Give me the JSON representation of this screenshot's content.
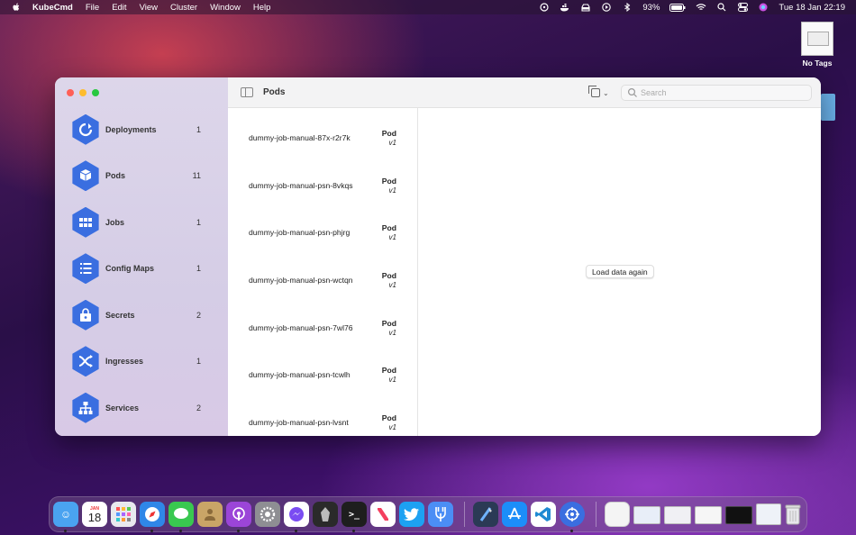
{
  "menubar": {
    "app_name": "KubeCmd",
    "items": [
      "File",
      "Edit",
      "View",
      "Cluster",
      "Window",
      "Help"
    ],
    "battery": "93%",
    "clock": "Tue 18 Jan  22:19"
  },
  "desktop": {
    "file_label": "No Tags"
  },
  "sidebar": {
    "items": [
      {
        "label": "Deployments",
        "count": "1",
        "icon": "deployments-icon"
      },
      {
        "label": "Pods",
        "count": "11",
        "icon": "pods-icon"
      },
      {
        "label": "Jobs",
        "count": "1",
        "icon": "jobs-icon"
      },
      {
        "label": "Config Maps",
        "count": "1",
        "icon": "configmaps-icon"
      },
      {
        "label": "Secrets",
        "count": "2",
        "icon": "secrets-icon"
      },
      {
        "label": "Ingresses",
        "count": "1",
        "icon": "ingresses-icon"
      },
      {
        "label": "Services",
        "count": "2",
        "icon": "services-icon"
      }
    ],
    "accent": "#3a6ee0"
  },
  "toolbar": {
    "title": "Pods",
    "search_placeholder": "Search"
  },
  "pods": [
    {
      "name": "dummy-job-manual-87x-r2r7k",
      "kind": "Pod",
      "version": "v1"
    },
    {
      "name": "dummy-job-manual-psn-8vkqs",
      "kind": "Pod",
      "version": "v1"
    },
    {
      "name": "dummy-job-manual-psn-phjrg",
      "kind": "Pod",
      "version": "v1"
    },
    {
      "name": "dummy-job-manual-psn-wctqn",
      "kind": "Pod",
      "version": "v1"
    },
    {
      "name": "dummy-job-manual-psn-7wl76",
      "kind": "Pod",
      "version": "v1"
    },
    {
      "name": "dummy-job-manual-psn-tcwlh",
      "kind": "Pod",
      "version": "v1"
    },
    {
      "name": "dummy-job-manual-psn-lvsnt",
      "kind": "Pod",
      "version": "v1"
    }
  ],
  "detail": {
    "reload_label": "Load data again"
  },
  "dock": {
    "calendar_month": "JAN",
    "calendar_day": "18"
  }
}
